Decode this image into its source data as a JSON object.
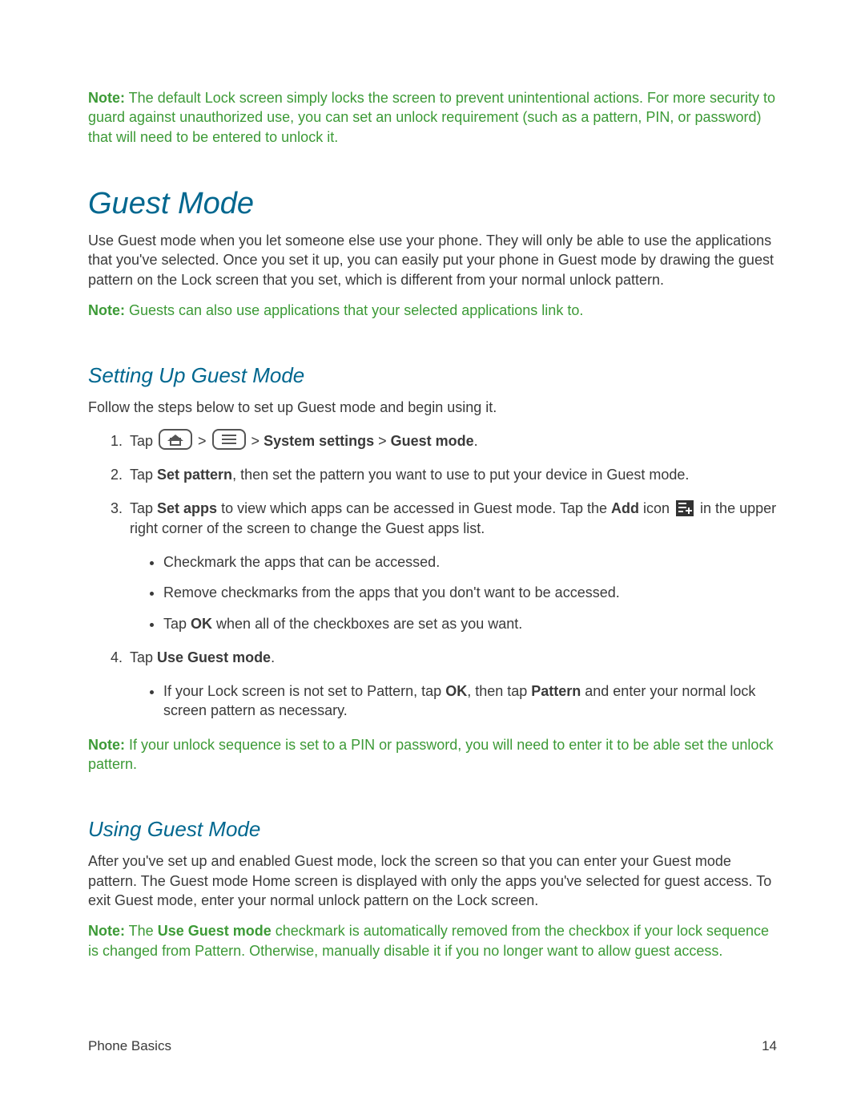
{
  "intro_note": {
    "label": "Note:",
    "text": " The default Lock screen simply locks the screen to prevent unintentional actions. For more security to guard against unauthorized use, you can set an unlock requirement (such as a pattern, PIN, or password) that will need to be entered to unlock it."
  },
  "guest_mode": {
    "heading": "Guest Mode",
    "intro": "Use Guest mode when you let someone else use your phone. They will only be able to use the applications that you've selected. Once you set it up, you can easily put your phone in Guest mode by drawing the guest pattern on the Lock screen that you set, which is different from your normal unlock pattern.",
    "note_label": "Note:",
    "note_text": " Guests can also use applications that your selected applications link to."
  },
  "setting_up": {
    "heading": "Setting Up Guest Mode",
    "intro": "Follow the steps below to set up Guest mode and begin using it.",
    "step1_pre": "Tap ",
    "step1_sep": " > ",
    "step1_sys": "System settings",
    "step1_gm": "Guest mode",
    "step1_end": ".",
    "step2_pre": "Tap ",
    "step2_bold": "Set pattern",
    "step2_post": ", then set the pattern you want to use to put your device in Guest mode.",
    "step3_pre": "Tap ",
    "step3_bold1": "Set apps",
    "step3_mid": " to view which apps can be accessed in Guest mode. Tap the ",
    "step3_bold2": "Add",
    "step3_post1": " icon ",
    "step3_post2": " in the upper right corner of the screen to change the Guest apps list.",
    "bullets": {
      "b1": "Checkmark the apps that can be accessed.",
      "b2": "Remove checkmarks from the apps that you don't want to be accessed.",
      "b3_pre": "Tap ",
      "b3_bold": "OK",
      "b3_post": " when all of the checkboxes are set as you want."
    },
    "step4_pre": "Tap ",
    "step4_bold": "Use Guest mode",
    "step4_post": ".",
    "step4_bullet_pre": "If your Lock screen is not set to Pattern, tap ",
    "step4_bullet_ok": "OK",
    "step4_bullet_mid": ", then tap ",
    "step4_bullet_pattern": "Pattern",
    "step4_bullet_post": " and enter your normal lock screen pattern as necessary.",
    "end_note_label": "Note:",
    "end_note_text": " If your unlock sequence is set to a PIN or password, you will need to enter it to be able set the unlock pattern."
  },
  "using": {
    "heading": "Using Guest Mode",
    "para": "After you've set up and enabled Guest mode, lock the screen so that you can enter your Guest mode pattern. The Guest mode Home screen is displayed with only the apps you've selected for guest access. To exit Guest mode, enter your normal unlock pattern on the Lock screen.",
    "note_label": "Note:",
    "note_pre": " The ",
    "note_bold": "Use Guest mode",
    "note_post": " checkmark is automatically removed from the checkbox if your lock sequence is changed from Pattern. Otherwise, manually disable it if you no longer want to allow guest access."
  },
  "footer": {
    "section": "Phone Basics",
    "page": "14"
  }
}
